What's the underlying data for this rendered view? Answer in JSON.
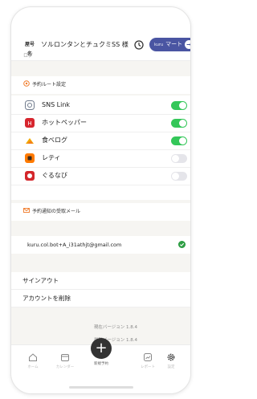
{
  "header": {
    "logo_text": "屋号名",
    "shop_name": "ソルロンタンとチュクミSS 様",
    "scroll_peek": "ログ",
    "kuru_brand": "kuru",
    "kuru_label": "マート",
    "kuru_arrow": "→"
  },
  "reservation_routes": {
    "title": "予約ルート設定",
    "items": [
      {
        "label": "SNS Link",
        "icon_color": "#6f7a8c",
        "enabled": true
      },
      {
        "label": "ホットペッパー",
        "icon_color": "#d7262e",
        "enabled": true
      },
      {
        "label": "食べログ",
        "icon_color": "#f2a900",
        "enabled": true
      },
      {
        "label": "レティ",
        "icon_color": "#ff7a00",
        "enabled": false
      },
      {
        "label": "ぐるなび",
        "icon_color": "#d4272c",
        "enabled": false
      }
    ]
  },
  "notification_email": {
    "title": "予約通知の受取メール",
    "address": "kuru.col.bot+A_i31athjt@gmail.com"
  },
  "account": {
    "signout": "サインアウト",
    "delete": "アカウントを削除"
  },
  "versions": {
    "current": "現在バージョン 1.8.4",
    "latest": "最新バージョン 1.8.4"
  },
  "tabbar": {
    "home": "ホーム",
    "calendar": "カレンダー",
    "new_reservation": "新規予約",
    "report": "レポート",
    "settings": "設定"
  },
  "colors": {
    "accent": "#4a55a2",
    "toggle_on": "#34c759",
    "toggle_off": "#e5e5ea",
    "section_icon": "#f07b2a"
  }
}
